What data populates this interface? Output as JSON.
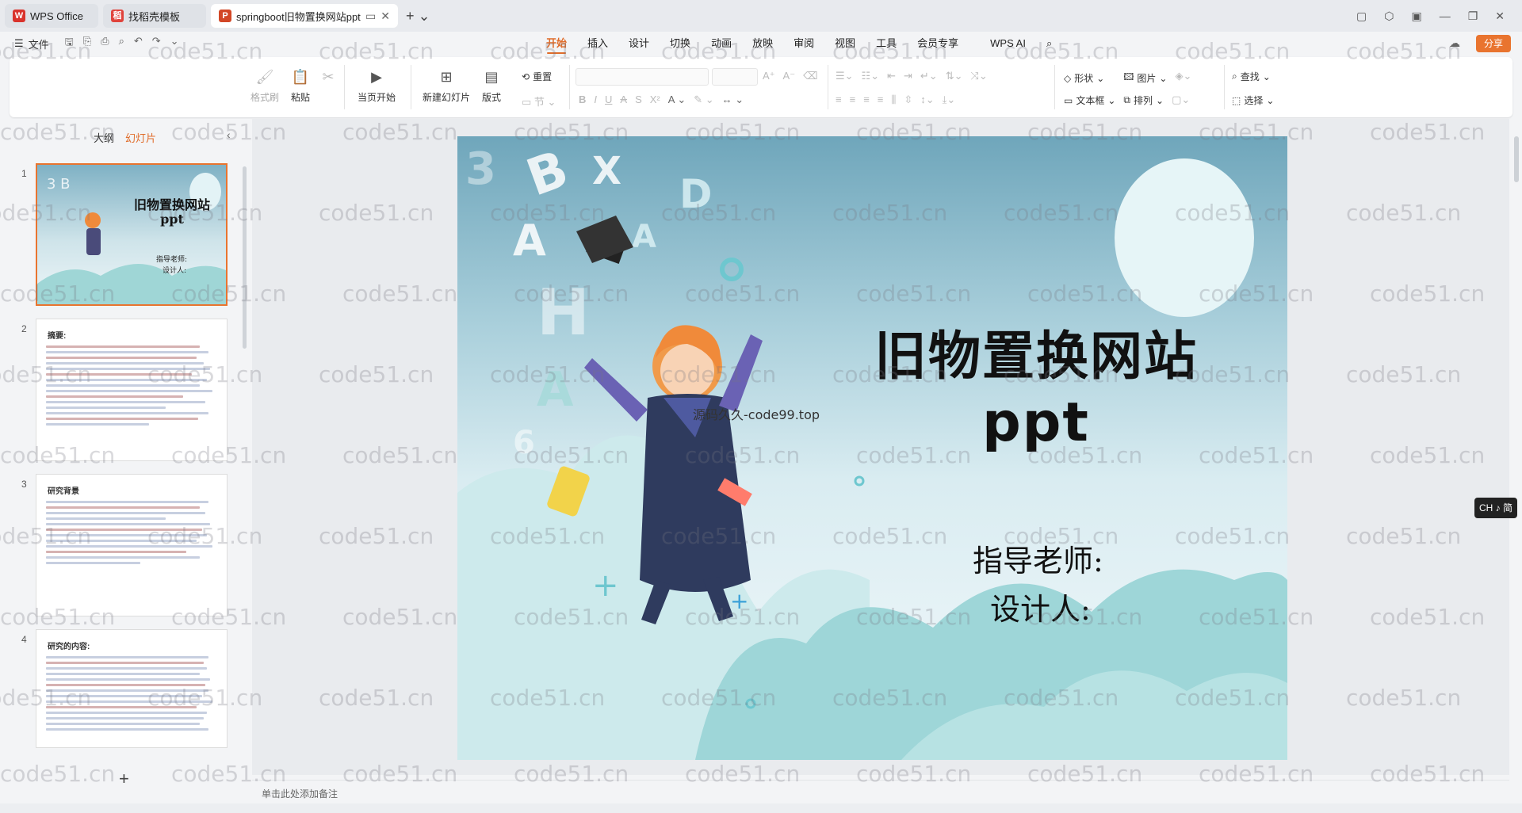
{
  "tabs": [
    {
      "label": "WPS Office",
      "icon": "wps-logo-icon",
      "color": "#d9332c"
    },
    {
      "label": "找稻壳模板",
      "icon": "docer-icon",
      "color": "#e0433c"
    },
    {
      "label": "springboot旧物置换网站ppt",
      "icon": "ppt-icon",
      "color": "#d24726"
    }
  ],
  "menu": {
    "file": "文件",
    "tabs": [
      "开始",
      "插入",
      "设计",
      "切换",
      "动画",
      "放映",
      "审阅",
      "视图",
      "工具",
      "会员专享",
      "WPS AI"
    ],
    "active_tab": "开始",
    "share": "分享"
  },
  "ribbon": {
    "format_painter": "格式刷",
    "paste": "粘贴",
    "from_current": "当页开始",
    "new_slide": "新建幻灯片",
    "layout": "版式",
    "reset": "重置",
    "shape": "形状",
    "picture": "图片",
    "find": "查找",
    "textbox": "文本框",
    "arrange": "排列",
    "select": "选择"
  },
  "left_panel": {
    "outline_tab": "大纲",
    "slides_tab": "幻灯片",
    "thumbs": [
      {
        "num": "1",
        "title": "旧物置换网站",
        "title2": "ppt",
        "line1": "指导老师:",
        "line2": "设计人:"
      },
      {
        "num": "2",
        "title": "摘要:"
      },
      {
        "num": "3",
        "title": "研究背景"
      },
      {
        "num": "4",
        "title": "研究的内容:"
      }
    ]
  },
  "slide": {
    "title_line1": "旧物置换网站",
    "title_line2": "ppt",
    "advisor": "指导老师:",
    "designer": "设计人:",
    "overlay": "源码久久-code99.top"
  },
  "notes_placeholder": "单击此处添加备注",
  "ime": "CH ♪ 简",
  "watermark": "code51.cn",
  "colors": {
    "accent": "#e9742f",
    "slide_top": "#6fa6bb",
    "slide_bottom": "#f3f9fb"
  }
}
